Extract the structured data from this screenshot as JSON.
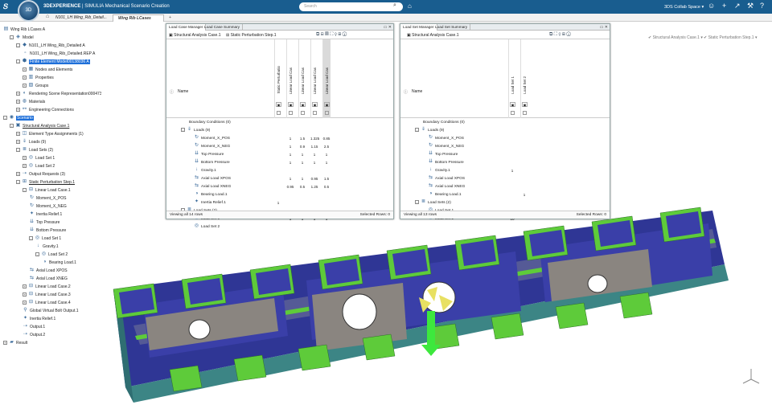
{
  "app": {
    "brand": "3DEXPERIENCE",
    "product": "SIMULIA",
    "role": "Mechanical Scenario Creation",
    "collab_space": "3DS Collab Space"
  },
  "search": {
    "placeholder": "Search"
  },
  "tabs": [
    {
      "label": "N101_LH Wing_Rib_Detail..."
    },
    {
      "label": "Wing Rib LCases"
    },
    {
      "label": "+"
    }
  ],
  "tree": [
    {
      "label": "Wing Rib LCases A",
      "indent": 0,
      "exp": "",
      "icon": "folder-icon"
    },
    {
      "label": "Model",
      "indent": 1,
      "exp": "-",
      "icon": "model-icon"
    },
    {
      "label": "N101_LH Wing_Rib_Detailed A",
      "indent": 2,
      "exp": "-",
      "icon": "part-icon"
    },
    {
      "label": "N101_LH Wing_Rib_Detailed.REP A",
      "indent": 3,
      "exp": "",
      "icon": "rep-icon"
    },
    {
      "label": "Finite Element Model00138036 A",
      "indent": 2,
      "exp": "-",
      "icon": "fem-icon",
      "sel": true
    },
    {
      "label": "Nodes and Elements",
      "indent": 3,
      "exp": "+",
      "icon": "mesh-icon"
    },
    {
      "label": "Properties",
      "indent": 3,
      "exp": "+",
      "icon": "props-icon"
    },
    {
      "label": "Groups",
      "indent": 3,
      "exp": "+",
      "icon": "groups-icon"
    },
    {
      "label": "Rendering Scene Representation00047311",
      "indent": 2,
      "exp": "+",
      "icon": "render-icon"
    },
    {
      "label": "Materials",
      "indent": 2,
      "exp": "+",
      "icon": "material-icon"
    },
    {
      "label": "Engineering Connections",
      "indent": 2,
      "exp": "+",
      "icon": "connection-icon"
    },
    {
      "label": "Scenario",
      "indent": 0,
      "exp": "-",
      "icon": "scenario-icon",
      "sel": true
    },
    {
      "label": "Structural Analysis Case.1",
      "indent": 1,
      "exp": "-",
      "icon": "case-icon",
      "ul": true
    },
    {
      "label": "Element Type Assignments (1)",
      "indent": 2,
      "exp": "+",
      "icon": "element-icon"
    },
    {
      "label": "Loads (9)",
      "indent": 2,
      "exp": "+",
      "icon": "loads-icon"
    },
    {
      "label": "Load Sets (2)",
      "indent": 2,
      "exp": "-",
      "icon": "loadsets-icon"
    },
    {
      "label": "Load Set 1",
      "indent": 3,
      "exp": "+",
      "icon": "loadset-icon"
    },
    {
      "label": "Load Set 2",
      "indent": 3,
      "exp": "+",
      "icon": "loadset-icon"
    },
    {
      "label": "Output Requests (3)",
      "indent": 2,
      "exp": "+",
      "icon": "output-icon"
    },
    {
      "label": "Static Perturbation Step.1",
      "indent": 2,
      "exp": "-",
      "icon": "step-icon",
      "ul": true
    },
    {
      "label": "Linear Load Case.1",
      "indent": 3,
      "exp": "-",
      "icon": "loadcase-icon"
    },
    {
      "label": "Moment_X_POS",
      "indent": 4,
      "exp": "",
      "icon": "moment-icon"
    },
    {
      "label": "Moment_X_NEG",
      "indent": 4,
      "exp": "",
      "icon": "moment-icon"
    },
    {
      "label": "Inertia Relief.1",
      "indent": 4,
      "exp": "",
      "icon": "inertia-icon"
    },
    {
      "label": "Top Pressure",
      "indent": 4,
      "exp": "",
      "icon": "pressure-icon"
    },
    {
      "label": "Bottom Pressure",
      "indent": 4,
      "exp": "",
      "icon": "pressure-icon"
    },
    {
      "label": "Load Set 1",
      "indent": 4,
      "exp": "-",
      "icon": "loadset-icon"
    },
    {
      "label": "Gravity.1",
      "indent": 5,
      "exp": "",
      "icon": "gravity-icon"
    },
    {
      "label": "Load Set 2",
      "indent": 5,
      "exp": "-",
      "icon": "loadset-icon"
    },
    {
      "label": "Bearing Load.1",
      "indent": 6,
      "exp": "",
      "icon": "bearing-icon"
    },
    {
      "label": "Axial Load XPOS",
      "indent": 4,
      "exp": "",
      "icon": "axial-icon"
    },
    {
      "label": "Axial Load XNEG",
      "indent": 4,
      "exp": "",
      "icon": "axial-icon"
    },
    {
      "label": "Linear Load Case.2",
      "indent": 3,
      "exp": "+",
      "icon": "loadcase-icon"
    },
    {
      "label": "Linear Load Case.3",
      "indent": 3,
      "exp": "+",
      "icon": "loadcase-icon"
    },
    {
      "label": "Linear Load Case.4",
      "indent": 3,
      "exp": "+",
      "icon": "loadcase-icon"
    },
    {
      "label": "Global Virtual Bolt Output.1",
      "indent": 3,
      "exp": "",
      "icon": "bolt-icon"
    },
    {
      "label": "Inertia Relief.1",
      "indent": 3,
      "exp": "",
      "icon": "inertia-icon"
    },
    {
      "label": "Output.1",
      "indent": 3,
      "exp": "",
      "icon": "output-icon"
    },
    {
      "label": "Output.2",
      "indent": 3,
      "exp": "",
      "icon": "output-icon"
    },
    {
      "label": "Result",
      "indent": 0,
      "exp": "+",
      "icon": "result-icon"
    }
  ],
  "lcm": {
    "tabs": [
      "Load Case Manager",
      "Load Case Summary"
    ],
    "title1": "Structural Analysis Case.1",
    "title2": "Static Perturbation Step.1",
    "name_header": "Name",
    "columns": [
      "Static Perturbatio",
      "Linear Load Cas",
      "Linear Load Cas",
      "Linear Load Cas",
      "Linear Load Cas"
    ],
    "rows": [
      {
        "name": "Boundary Conditions (0)",
        "level": 0,
        "exp": "",
        "icon": "",
        "vals": [
          "",
          "",
          "",
          "",
          ""
        ]
      },
      {
        "name": "Loads (9)",
        "level": 0,
        "exp": "-",
        "icon": "loads-icon",
        "vals": [
          "",
          "",
          "",
          "",
          ""
        ]
      },
      {
        "name": "Moment_X_POS",
        "level": 1,
        "exp": "",
        "icon": "moment-icon",
        "vals": [
          "",
          "1",
          "1.5",
          "1.325",
          "0.85"
        ]
      },
      {
        "name": "Moment_X_NEG",
        "level": 1,
        "exp": "",
        "icon": "moment-icon",
        "vals": [
          "",
          "1",
          "0.9",
          "1.15",
          "2.5"
        ]
      },
      {
        "name": "Top Pressure",
        "level": 1,
        "exp": "",
        "icon": "pressure-icon",
        "vals": [
          "",
          "1",
          "1",
          "1",
          "1"
        ]
      },
      {
        "name": "Bottom Pressure",
        "level": 1,
        "exp": "",
        "icon": "pressure-icon",
        "vals": [
          "",
          "1",
          "1",
          "1",
          "1"
        ]
      },
      {
        "name": "Gravity.1",
        "level": 1,
        "exp": "",
        "icon": "gravity-icon",
        "vals": [
          "",
          "",
          "",
          "",
          ""
        ]
      },
      {
        "name": "Axial Load XPOS",
        "level": 1,
        "exp": "",
        "icon": "axial-icon",
        "vals": [
          "",
          "1",
          "1",
          "0.95",
          "1.5"
        ]
      },
      {
        "name": "Axial Load XNEG",
        "level": 1,
        "exp": "",
        "icon": "axial-icon",
        "vals": [
          "",
          "0.95",
          "0.5",
          "1.25",
          "0.5"
        ]
      },
      {
        "name": "Bearing Load.1",
        "level": 1,
        "exp": "",
        "icon": "bearing-icon",
        "vals": [
          "",
          "",
          "",
          "",
          ""
        ]
      },
      {
        "name": "Inertia Relief.1",
        "level": 1,
        "exp": "",
        "icon": "inertia-icon",
        "vals": [
          "1",
          "",
          "",
          "",
          ""
        ]
      },
      {
        "name": "Load Sets (2)",
        "level": 0,
        "exp": "-",
        "icon": "loadsets-icon",
        "vals": [
          "",
          "",
          "",
          "",
          ""
        ]
      },
      {
        "name": "Load Set 1",
        "level": 1,
        "exp": "",
        "icon": "loadset-icon",
        "vals": [
          "",
          "1",
          "1",
          "1",
          "1"
        ]
      },
      {
        "name": "Load Set 2",
        "level": 1,
        "exp": "",
        "icon": "loadset-icon",
        "vals": [
          "",
          "",
          "",
          "",
          ""
        ]
      }
    ],
    "footer_left": "Viewing all 14 rows",
    "footer_right": "Selected Rows: 0"
  },
  "lsm": {
    "tabs": [
      "Load Set Manager",
      "Load Set Summary"
    ],
    "title1": "Structural Analysis Case.1",
    "name_header": "Name",
    "columns": [
      "Load Set 1",
      "Load Set 2"
    ],
    "rows": [
      {
        "name": "Boundary Conditions (0)",
        "level": 0,
        "exp": "",
        "icon": "",
        "vals": [
          "",
          ""
        ]
      },
      {
        "name": "Loads (9)",
        "level": 0,
        "exp": "-",
        "icon": "loads-icon",
        "vals": [
          "",
          ""
        ]
      },
      {
        "name": "Moment_X_POS",
        "level": 1,
        "exp": "",
        "icon": "moment-icon",
        "vals": [
          "",
          ""
        ]
      },
      {
        "name": "Moment_X_NEG",
        "level": 1,
        "exp": "",
        "icon": "moment-icon",
        "vals": [
          "",
          ""
        ]
      },
      {
        "name": "Top Pressure",
        "level": 1,
        "exp": "",
        "icon": "pressure-icon",
        "vals": [
          "",
          ""
        ]
      },
      {
        "name": "Bottom Pressure",
        "level": 1,
        "exp": "",
        "icon": "pressure-icon",
        "vals": [
          "",
          ""
        ]
      },
      {
        "name": "Gravity.1",
        "level": 1,
        "exp": "",
        "icon": "gravity-icon",
        "vals": [
          "1",
          ""
        ]
      },
      {
        "name": "Axial Load XPOS",
        "level": 1,
        "exp": "",
        "icon": "axial-icon",
        "vals": [
          "",
          ""
        ]
      },
      {
        "name": "Axial Load XNEG",
        "level": 1,
        "exp": "",
        "icon": "axial-icon",
        "vals": [
          "",
          ""
        ]
      },
      {
        "name": "Bearing Load.1",
        "level": 1,
        "exp": "",
        "icon": "bearing-icon",
        "vals": [
          "",
          "1"
        ]
      },
      {
        "name": "Load Sets (2)",
        "level": 0,
        "exp": "-",
        "icon": "loadsets-icon",
        "vals": [
          "",
          ""
        ]
      },
      {
        "name": "Load Set 1",
        "level": 1,
        "exp": "",
        "icon": "loadset-icon",
        "vals": [
          "",
          ""
        ]
      },
      {
        "name": "Load Set 2",
        "level": 1,
        "exp": "",
        "icon": "loadset-icon",
        "vals": [
          "10",
          ""
        ]
      }
    ],
    "footer_left": "Viewing all 13 rows",
    "footer_right": "Selected Rows: 0"
  },
  "checks": [
    "Structural Analysis Case.1",
    "Static Perturbation Step.1"
  ],
  "colors": {
    "topbar": "#195d8f",
    "selection": "#1e6fd9",
    "rib_face": "#3a3fa8",
    "rib_edge": "#4a8c8c",
    "stiffener": "#5ecb3a",
    "plate": "#8a8580"
  }
}
